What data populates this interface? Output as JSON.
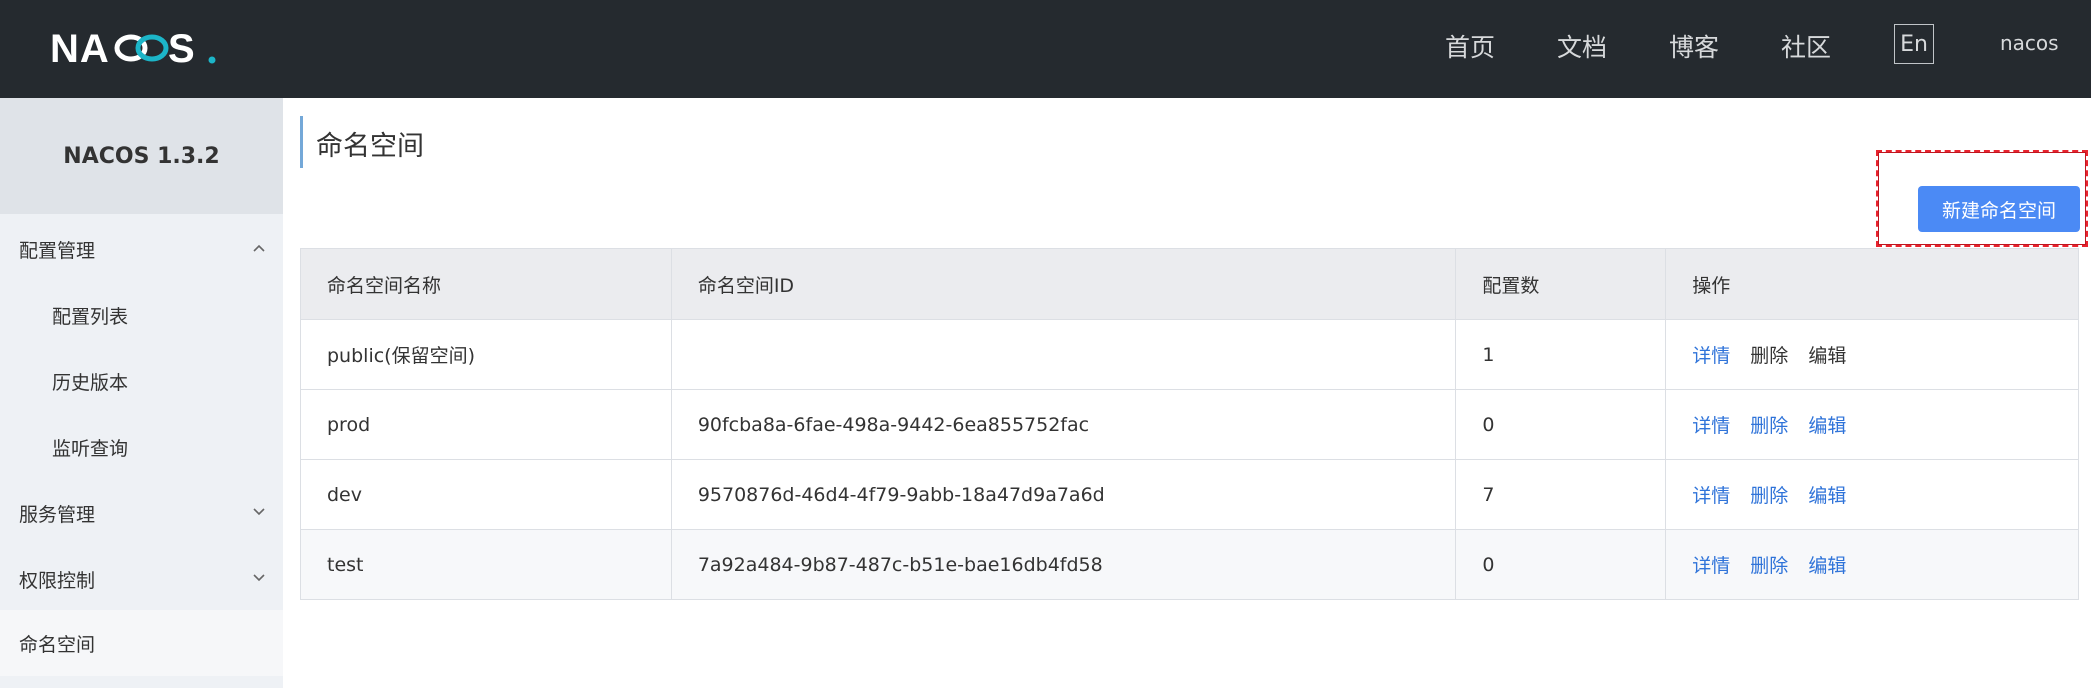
{
  "header": {
    "logo_text": "NACOS.",
    "nav": [
      "首页",
      "文档",
      "博客",
      "社区"
    ],
    "lang_button": "En",
    "username": "nacos",
    "colors": {
      "background": "#252a2f",
      "logo_accent": "#1cb5c8"
    }
  },
  "sidebar": {
    "version": "NACOS 1.3.2",
    "items": [
      {
        "label": "配置管理",
        "level": 1,
        "icon": "chevron-up-icon"
      },
      {
        "label": "配置列表",
        "level": 2
      },
      {
        "label": "历史版本",
        "level": 2
      },
      {
        "label": "监听查询",
        "level": 2
      },
      {
        "label": "服务管理",
        "level": 1,
        "icon": "chevron-down-icon"
      },
      {
        "label": "权限控制",
        "level": 1,
        "icon": "chevron-down-icon"
      },
      {
        "label": "命名空间",
        "level": 1,
        "active": true
      }
    ]
  },
  "main": {
    "title": "命名空间",
    "create_button": "新建命名空间",
    "table": {
      "columns": [
        "命名空间名称",
        "命名空间ID",
        "配置数",
        "操作"
      ],
      "rows": [
        {
          "name": "public(保留空间)",
          "id": "",
          "count": "1",
          "ops": [
            "详情",
            "删除",
            "编辑"
          ]
        },
        {
          "name": "prod",
          "id": "90fcba8a-6fae-498a-9442-6ea855752fac",
          "count": "0",
          "ops": [
            "详情",
            "删除",
            "编辑"
          ]
        },
        {
          "name": "dev",
          "id": "9570876d-46d4-4f79-9abb-18a47d9a7a6d",
          "count": "7",
          "ops": [
            "详情",
            "删除",
            "编辑"
          ]
        },
        {
          "name": "test",
          "id": "7a92a484-9b87-487c-b51e-bae16db4fd58",
          "count": "0",
          "ops": [
            "详情",
            "删除",
            "编辑"
          ]
        }
      ]
    },
    "colors": {
      "primary": "#4b8af5",
      "link": "#2f73d9",
      "highlight": "#e8232e"
    }
  }
}
